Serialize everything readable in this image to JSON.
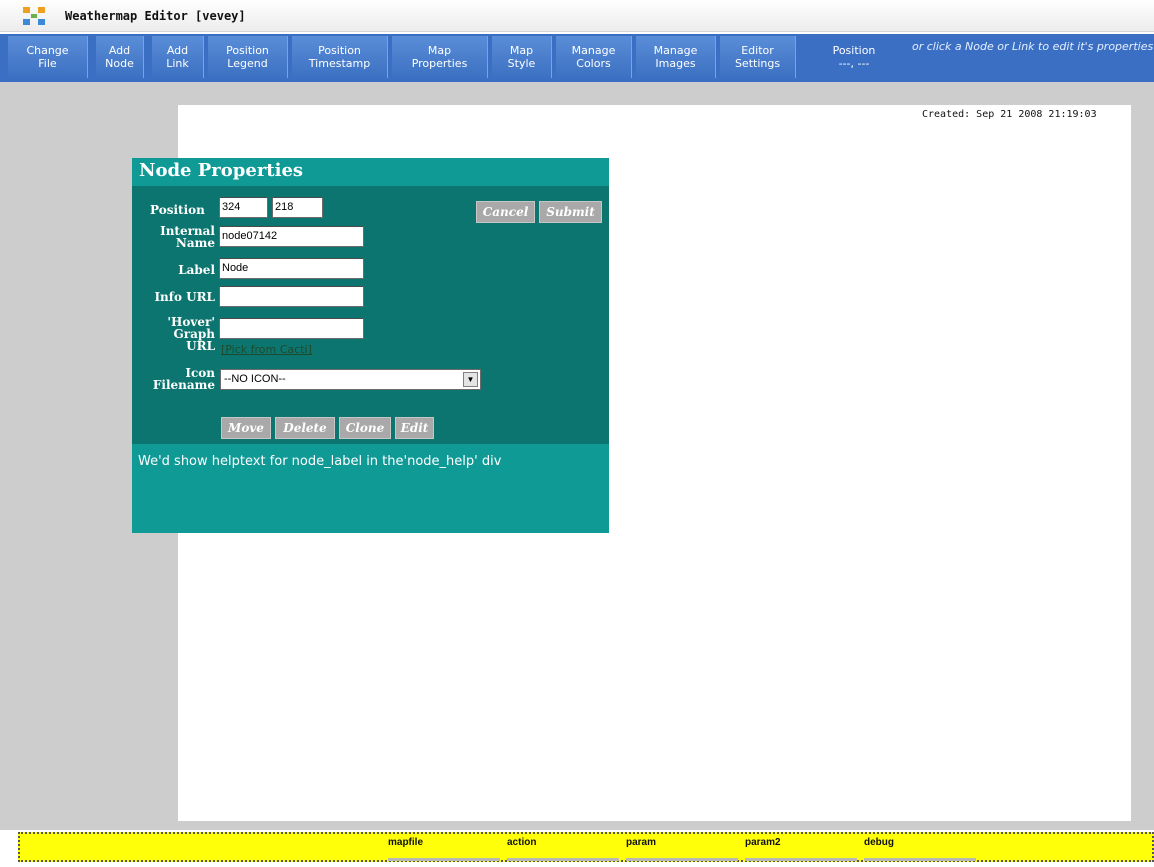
{
  "window": {
    "title": "Weathermap Editor [vevey]"
  },
  "toolbar": {
    "buttons": [
      {
        "label": "Change\nFile"
      },
      {
        "label": "Add\nNode"
      },
      {
        "label": "Add\nLink"
      },
      {
        "label": "Position\nLegend"
      },
      {
        "label": "Position\nTimestamp"
      },
      {
        "label": "Map\nProperties"
      },
      {
        "label": "Map\nStyle"
      },
      {
        "label": "Manage\nColors"
      },
      {
        "label": "Manage\nImages"
      },
      {
        "label": "Editor\nSettings"
      },
      {
        "label": "Position\n---, ---"
      }
    ],
    "hint": "or click a Node or Link to edit it's properties"
  },
  "map": {
    "created": "Created: Sep 21 2008 21:19:03"
  },
  "dialog": {
    "title": "Node Properties",
    "position_label": "Position",
    "position_x": "324",
    "position_y": "218",
    "internal_name_label": "Internal\nName",
    "internal_name_value": "node07142",
    "label_label": "Label",
    "label_value": "Node",
    "info_url_label": "Info URL",
    "info_url_value": "",
    "hover_label": "'Hover'\nGraph\nURL",
    "hover_value": "",
    "pick_link": "[Pick from Cacti]",
    "icon_label": "Icon\nFilename",
    "icon_selected": "--NO ICON--",
    "cancel_label": "Cancel",
    "submit_label": "Submit",
    "move_label": "Move",
    "delete_label": "Delete",
    "clone_label": "Clone",
    "edit_label": "Edit",
    "help_text": "We'd show helptext for node_label in the'node_help' div"
  },
  "debug": {
    "fields": [
      "mapfile",
      "action",
      "param",
      "param2",
      "debug"
    ]
  },
  "colors": {
    "toolbar": "#3b6fc4",
    "dialog_header": "#0f9a96",
    "dialog_body": "#0d756f",
    "debug_bar": "#ffff0a",
    "frame": "#cdcdcd"
  }
}
